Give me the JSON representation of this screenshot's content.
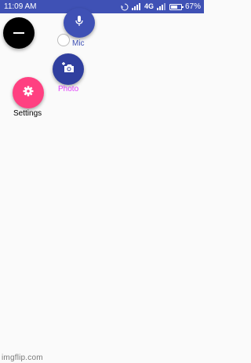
{
  "status_bar": {
    "time": "11:09 AM",
    "network": "4G",
    "battery": "67%",
    "battery_level": 0.67,
    "background": "#3f51b5"
  },
  "fabs": {
    "main": {
      "icon": "minus-icon",
      "color": "#000000"
    },
    "mic": {
      "label": "Mic",
      "icon": "microphone-icon",
      "color": "#3f51b5",
      "label_color": "#3f51b5"
    },
    "photo": {
      "label": "Photo",
      "icon": "camera-add-icon",
      "color": "#303f9f",
      "label_color": "#e040fb"
    },
    "settings": {
      "label": "Settings",
      "icon": "gear-icon",
      "color": "#ff4081",
      "label_color": "#000000"
    }
  },
  "watermark": "imgflip.com"
}
